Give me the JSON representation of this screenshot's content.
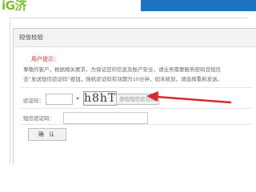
{
  "header": {
    "logo_text": "iG济"
  },
  "panel": {
    "title": "短信校验"
  },
  "tip": {
    "title": "用户提示：",
    "line1": "尊敬的客户，根据相关要求，为保证您的信息及账户安全，请业务需要服务密码且短信",
    "line2": "击“发送短信验证码”按钮，随机验证码有效期为10分钟，如未收到，请选择重新发送。"
  },
  "form": {
    "captcha_label": "验证码：",
    "captcha_value": "",
    "captcha_required_mark": "*",
    "captcha_image_text": "h8hT",
    "get_code_label": "获取短信验证码",
    "sms_label": "短信验证码：",
    "sms_value": "",
    "confirm_label": "确 认"
  },
  "colors": {
    "accent_blue": "#1f73c4",
    "logo_green": "#7bbf2a",
    "tip_red": "#e0302a",
    "arrow_red": "#d9272e"
  }
}
